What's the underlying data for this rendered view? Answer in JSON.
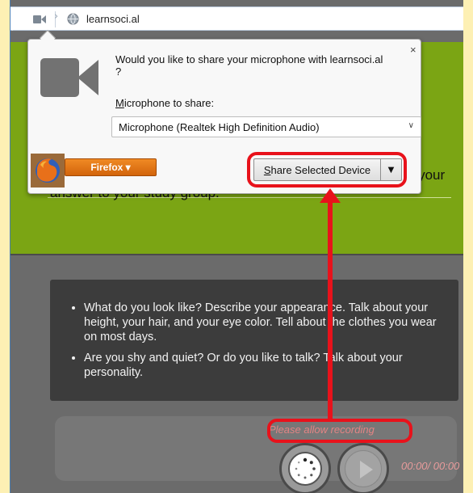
{
  "browser": {
    "url": "learnsoci.al"
  },
  "popup": {
    "message": "Would you like to share your microphone with learnsoci.al ?",
    "mic_label_accel": "M",
    "mic_label_rest": "icrophone to share:",
    "mic_selected": "Microphone (Realtek High Definition Audio)",
    "close": "×",
    "firefox_label": "Firefox ▾",
    "share_accel": "S",
    "share_rest": "hare Selected Device",
    "share_dropdown": "▼"
  },
  "page": {
    "instructions": "Choose one of the topics. Record your answer. Then submit your answer to your study group.",
    "topics": [
      "What do you look like? Describe your appearance. Talk about your height, your hair, and your eye color. Tell about the clothes you wear on most days.",
      "Are you shy and quiet? Or do you like to talk? Talk about your personality."
    ]
  },
  "recorder": {
    "status": "Please allow recording",
    "time": "00:00/ 00:00"
  },
  "colors": {
    "highlight": "#e8121b",
    "green": "#7ba514",
    "dark_panel": "#3c3c3c"
  },
  "icons": [
    "camera-icon",
    "globe-icon",
    "chevron-right-icon",
    "close-icon",
    "firefox-logo-icon",
    "spinner-icon",
    "play-icon"
  ]
}
